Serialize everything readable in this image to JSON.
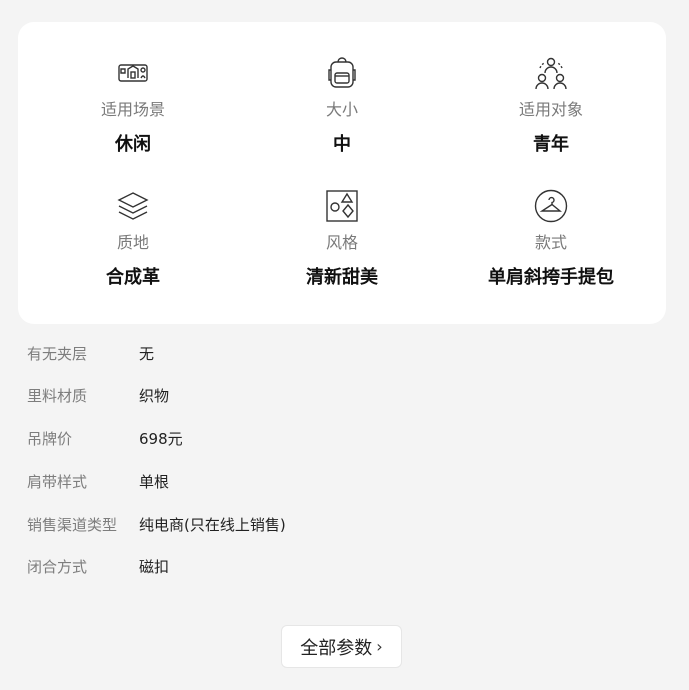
{
  "highlights": [
    {
      "icon": "scene-icon",
      "label": "适用场景",
      "value": "休闲"
    },
    {
      "icon": "backpack-icon",
      "label": "大小",
      "value": "中"
    },
    {
      "icon": "people-icon",
      "label": "适用对象",
      "value": "青年"
    },
    {
      "icon": "layers-icon",
      "label": "质地",
      "value": "合成革"
    },
    {
      "icon": "shapes-icon",
      "label": "风格",
      "value": "清新甜美"
    },
    {
      "icon": "hanger-icon",
      "label": "款式",
      "value": "单肩斜挎手提包"
    }
  ],
  "params": [
    {
      "key": "有无夹层",
      "value": "无"
    },
    {
      "key": "里料材质",
      "value": "织物"
    },
    {
      "key": "吊牌价",
      "value": "698元"
    },
    {
      "key": "肩带样式",
      "value": "单根"
    },
    {
      "key": "销售渠道类型",
      "value": "纯电商(只在线上销售)"
    },
    {
      "key": "闭合方式",
      "value": "磁扣"
    }
  ],
  "more_button": {
    "label": "全部参数",
    "chevron": "›"
  }
}
